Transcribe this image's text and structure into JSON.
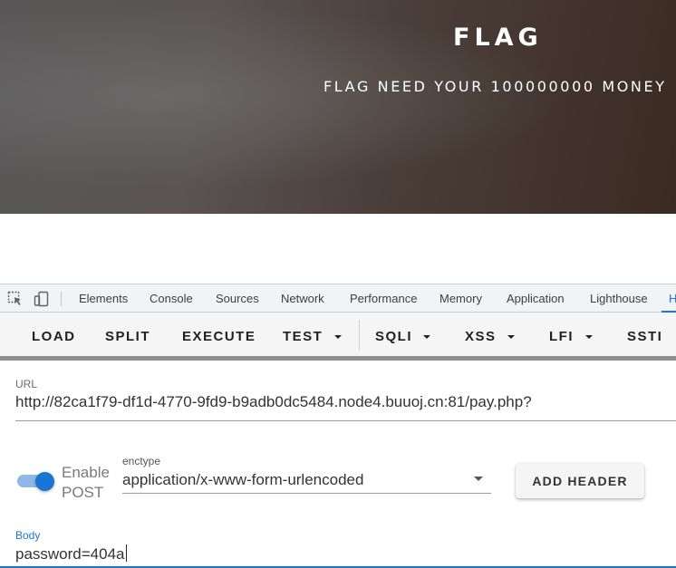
{
  "hero": {
    "title": "FLAG",
    "subtitle": "FLAG NEED YOUR 100000000 MONEY"
  },
  "devtools": {
    "icons": [
      "inspect-element-icon",
      "device-toolbar-icon"
    ],
    "tabs": [
      "Elements",
      "Console",
      "Sources",
      "Network",
      "Performance",
      "Memory",
      "Application",
      "Lighthouse"
    ],
    "active_tab_partial": "H"
  },
  "hackbar": {
    "buttons": {
      "load": "LOAD",
      "split": "SPLIT",
      "execute": "EXECUTE",
      "test": "TEST",
      "sqli": "SQLI",
      "xss": "XSS",
      "lfi": "LFI",
      "ssti": "SSTI"
    }
  },
  "form": {
    "url_label": "URL",
    "url_value": "http://82ca1f79-df1d-4770-9fd9-b9adb0dc5484.node4.buuoj.cn:81/pay.php?",
    "enable_post_label_line1": "Enable",
    "enable_post_label_line2": "POST",
    "enable_post_on": true,
    "enctype_label": "enctype",
    "enctype_value": "application/x-www-form-urlencoded",
    "add_header_label": "ADD HEADER",
    "body_label": "Body",
    "body_value": "password=404a"
  },
  "colors": {
    "accent": "#1976d2",
    "devtools_active": "#1a73e8"
  }
}
